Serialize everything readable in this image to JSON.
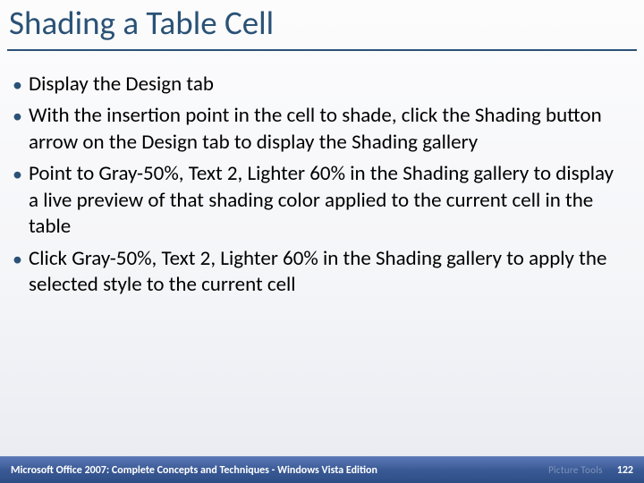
{
  "title": "Shading a Table Cell",
  "bullets": [
    "Display the Design tab",
    "With the insertion point in the cell to shade, click the Shading button arrow on the Design tab to display the Shading gallery",
    "Point to Gray-50%, Text 2, Lighter 60% in the Shading gallery to display a live preview of that shading color applied to the current cell in the table",
    "Click Gray-50%, Text 2, Lighter 60% in the Shading gallery to apply the selected style to the current cell"
  ],
  "footer": {
    "source": "Microsoft Office 2007: Complete Concepts and Techniques - Windows Vista Edition",
    "faded": "Picture Tools",
    "page": "122"
  }
}
